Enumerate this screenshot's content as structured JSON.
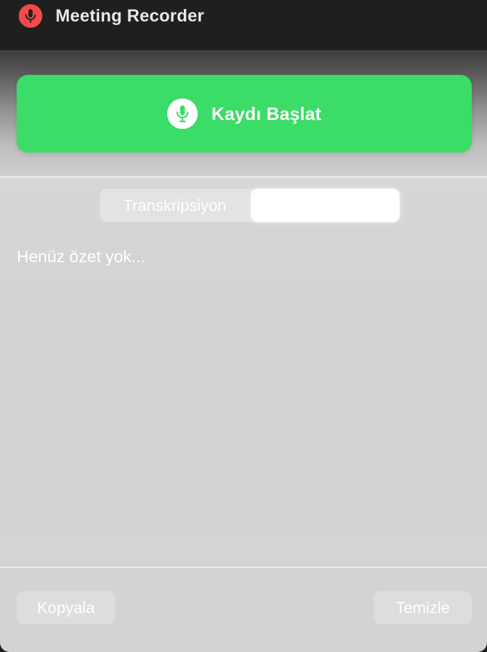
{
  "window": {
    "title": "Meeting Recorder",
    "app_icon": "microphone-icon",
    "accent_color": "#f5494a"
  },
  "record": {
    "label": "Kaydı Başlat",
    "icon": "microphone-icon",
    "color": "#3bdc68"
  },
  "tabs": [
    {
      "label": "Transkripsiyon",
      "selected": false
    },
    {
      "label": "",
      "selected": true
    }
  ],
  "summary": {
    "placeholder": "Henüz özet yok..."
  },
  "footer": {
    "copy_label": "Kopyala",
    "clear_label": "Temizle"
  }
}
